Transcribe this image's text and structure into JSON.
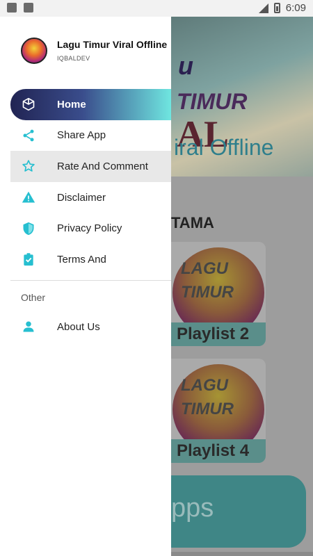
{
  "status_bar": {
    "time": "6:09"
  },
  "header": {
    "app_title": "Lagu Timur Viral Offline",
    "developer": "IQBALDEV"
  },
  "menu": [
    {
      "label": "Home",
      "icon": "cube-icon",
      "active": true
    },
    {
      "label": "Share App",
      "icon": "share-icon"
    },
    {
      "label": "Rate And Comment",
      "icon": "star-icon",
      "highlighted": true
    },
    {
      "label": "Disclaimer",
      "icon": "warning-icon"
    },
    {
      "label": "Privacy Policy",
      "icon": "shield-icon"
    },
    {
      "label": "Terms And",
      "icon": "clipboard-check-icon"
    }
  ],
  "section_other": "Other",
  "about": {
    "label": "About Us",
    "icon": "person-icon"
  },
  "background": {
    "banner_title_top": "u",
    "banner_title_mid": "TIMUR",
    "banner_title_big": "AL",
    "banner_subtitle": "iral Offline",
    "section_title": "TAMA",
    "card1_caption": "Playlist 2",
    "card2_caption": "Playlist 4",
    "disc_text": "LAGU TIMUR",
    "button_text": "pps"
  },
  "colors": {
    "accent": "#26bfd0",
    "drawer_gradient_start": "#212453",
    "drawer_gradient_end": "#6fe6e0"
  }
}
